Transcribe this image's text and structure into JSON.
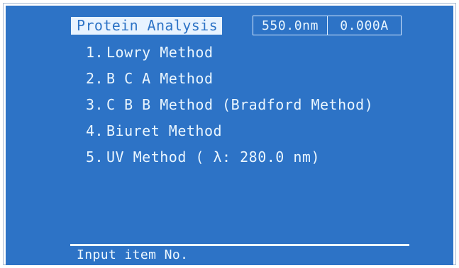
{
  "app": {
    "title": "Protein Analysis"
  },
  "status": {
    "wavelength": "550.0nm",
    "absorbance": "0.000A"
  },
  "menu": {
    "items": [
      {
        "number": "1.",
        "label": "Lowry Method"
      },
      {
        "number": "2.",
        "label": "B C A Method"
      },
      {
        "number": "3.",
        "label": "C B B Method (Bradford Method)"
      },
      {
        "number": "4.",
        "label": "Biuret Method"
      },
      {
        "number": "5.",
        "label": "UV Method ( λ:  280.0 nm)"
      }
    ]
  },
  "footer": {
    "prompt": "Input item No."
  },
  "colors": {
    "screen_background": "#2d73c6",
    "foreground": "#eaf6ff",
    "highlight": "#e8f3ff"
  }
}
